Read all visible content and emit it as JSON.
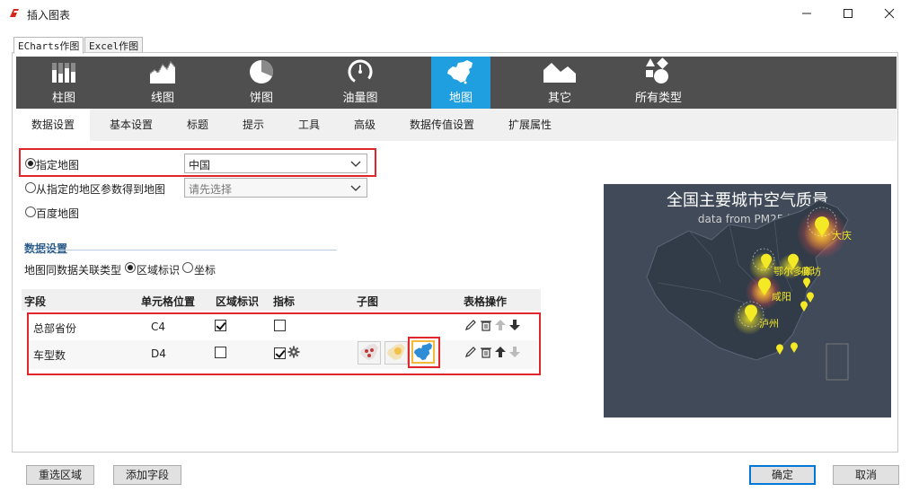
{
  "window": {
    "title": "插入图表",
    "minimize_icon": "minimize-icon",
    "maximize_icon": "maximize-icon",
    "close_icon": "close-icon"
  },
  "mode_tabs": [
    {
      "label": "ECharts作图",
      "active": true
    },
    {
      "label": "Excel作图",
      "active": false
    }
  ],
  "chart_types": [
    {
      "label": "柱图",
      "icon": "bar-chart-icon",
      "active": false
    },
    {
      "label": "线图",
      "icon": "line-chart-icon",
      "active": false
    },
    {
      "label": "饼图",
      "icon": "pie-chart-icon",
      "active": false
    },
    {
      "label": "油量图",
      "icon": "gauge-icon",
      "active": false
    },
    {
      "label": "地图",
      "icon": "china-map-icon",
      "active": true
    },
    {
      "label": "其它",
      "icon": "other-chart-icon",
      "active": false
    },
    {
      "label": "所有类型",
      "icon": "all-types-icon",
      "active": false
    }
  ],
  "sub_tabs": [
    {
      "label": "数据设置",
      "active": true
    },
    {
      "label": "基本设置",
      "active": false
    },
    {
      "label": "标题",
      "active": false
    },
    {
      "label": "提示",
      "active": false
    },
    {
      "label": "工具",
      "active": false
    },
    {
      "label": "高级",
      "active": false
    },
    {
      "label": "数据传值设置",
      "active": false
    },
    {
      "label": "扩展属性",
      "active": false
    }
  ],
  "map_source": {
    "specified": {
      "label": "指定地图",
      "selected": true,
      "value": "中国"
    },
    "from_param": {
      "label": "从指定的地区参数得到地图",
      "selected": false,
      "placeholder": "请先选择"
    },
    "baidu": {
      "label": "百度地图",
      "selected": false
    }
  },
  "data_settings": {
    "section_title": "数据设置",
    "assoc_label": "地图同数据关联类型",
    "options": [
      {
        "label": "区域标识",
        "selected": true
      },
      {
        "label": "坐标",
        "selected": false
      }
    ]
  },
  "field_table": {
    "headers": [
      "字段",
      "单元格位置",
      "区域标识",
      "指标",
      "子图",
      "表格操作"
    ],
    "rows": [
      {
        "field": "总部省份",
        "cell": "C4",
        "region_id": true,
        "metric": false,
        "has_settings": false,
        "sub_maps": []
      },
      {
        "field": "车型数",
        "cell": "D4",
        "region_id": false,
        "metric": true,
        "has_settings": true,
        "sub_maps": [
          "scatter-map-thumb",
          "heat-map-thumb",
          "china-map-thumb"
        ]
      }
    ],
    "op_icons": [
      "edit-icon",
      "delete-icon",
      "move-up-icon",
      "move-down-icon"
    ]
  },
  "preview": {
    "title": "全国主要城市空气质量",
    "subtitle": "data from PM25.in",
    "cities": [
      "大庆",
      "鄂尔多斯",
      "廊坊",
      "咸阳",
      "泸州"
    ]
  },
  "footer": {
    "reselect": "重选区域",
    "add_field": "添加字段",
    "ok": "确定",
    "cancel": "取消"
  },
  "colors": {
    "active_tab": "#1f9ee0",
    "toolbar_bg": "#4f4f4f",
    "highlight_red": "#e0262a",
    "map_bg": "#404a59",
    "map_marker": "#f4e925"
  }
}
